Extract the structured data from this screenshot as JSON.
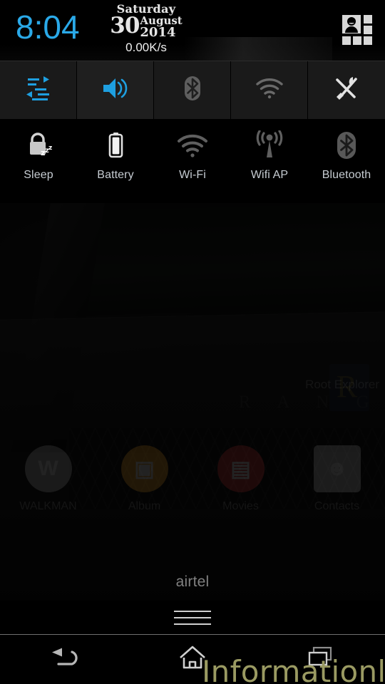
{
  "status_bar": {
    "clock": "8:04",
    "date": {
      "weekday": "Saturday",
      "day": "30",
      "month": "August",
      "year": "2014"
    },
    "network_speed": "0.00K/s",
    "user_switch_icon": "user-grid-icon"
  },
  "toggle_strip": {
    "items": [
      {
        "name": "data-traffic",
        "icon": "data-transfer-icon",
        "state": "on",
        "color": "#1e9fe0"
      },
      {
        "name": "volume",
        "icon": "volume-up-icon",
        "state": "on",
        "color": "#1e9fe0"
      },
      {
        "name": "bluetooth",
        "icon": "bluetooth-icon",
        "state": "off",
        "color": "#6a6a6a"
      },
      {
        "name": "wifi",
        "icon": "wifi-icon",
        "state": "off",
        "color": "#6a6a6a"
      },
      {
        "name": "settings",
        "icon": "tools-icon",
        "state": "on",
        "color": "#e8e8e8"
      }
    ]
  },
  "quick_tiles": [
    {
      "label": "Sleep",
      "icon": "lock-sleep-icon",
      "state": "off"
    },
    {
      "label": "Battery",
      "icon": "battery-icon",
      "state": "off"
    },
    {
      "label": "Wi-Fi",
      "icon": "wifi-icon",
      "state": "off"
    },
    {
      "label": "Wifi AP",
      "icon": "hotspot-icon",
      "state": "off"
    },
    {
      "label": "Bluetooth",
      "icon": "bluetooth-icon",
      "state": "off"
    }
  ],
  "homescreen": {
    "carrier": "airtel",
    "folder_label": "Root Explorer",
    "wallpaper_wordmark": "R A N G E",
    "dock": [
      {
        "label": "WALKMAN",
        "icon": "walkman-icon",
        "color": "#b7b7b7"
      },
      {
        "label": "Album",
        "icon": "album-icon",
        "color": "#f5a623"
      },
      {
        "label": "Movies",
        "icon": "movies-icon",
        "color": "#e03a3a"
      },
      {
        "label": "Contacts",
        "icon": "contacts-icon",
        "color": "#cfcfcf"
      }
    ]
  },
  "drag_handle": {
    "icon": "drag-handle-icon"
  },
  "navbar": [
    {
      "name": "back",
      "icon": "back-arrow-icon"
    },
    {
      "name": "home",
      "icon": "home-icon"
    },
    {
      "name": "recents",
      "icon": "recent-apps-icon"
    }
  ],
  "watermark": {
    "text": "Informationlord"
  },
  "colors": {
    "accent": "#1e9fe0",
    "panel_bg": "#000000",
    "toggle_bg": "#1a1a1a",
    "tile_label": "#c6ccd2",
    "icon_off": "#6a6a6a",
    "watermark": "#9a9a62"
  }
}
